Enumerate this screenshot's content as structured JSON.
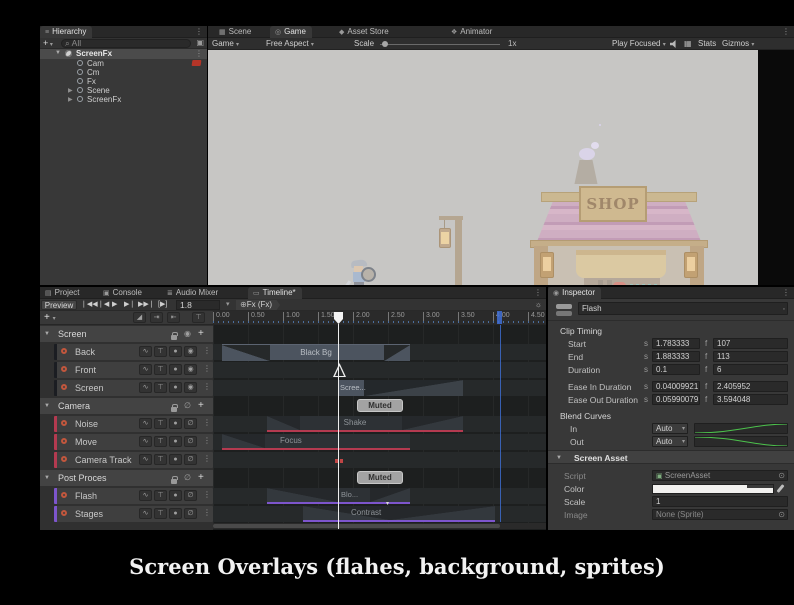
{
  "caption": "Screen Overlays (flahes, background, sprites)",
  "hierarchy": {
    "tab": "Hierarchy",
    "add_label": "+",
    "search_value": "All",
    "root": "ScreenFx",
    "children": [
      {
        "name": "Cam"
      },
      {
        "name": "Cm"
      },
      {
        "name": "Fx"
      },
      {
        "name": "Scene"
      },
      {
        "name": "ScreenFx"
      }
    ]
  },
  "game": {
    "tabs": [
      {
        "label": "Scene"
      },
      {
        "label": "Game"
      },
      {
        "label": "Asset Store"
      },
      {
        "label": "Animator"
      }
    ],
    "toolbar": {
      "display": "Game",
      "aspect": "Free Aspect",
      "scale_label": "Scale",
      "scale_value": "1x",
      "play_focused": "Play Focused",
      "stats_label": "Stats",
      "gizmos_label": "Gizmos"
    },
    "scene": {
      "shop_sign": "SHOP"
    }
  },
  "timeline": {
    "tabs": [
      {
        "label": "Project"
      },
      {
        "label": "Console"
      },
      {
        "label": "Audio Mixer"
      },
      {
        "label": "Timeline*"
      }
    ],
    "transport": {
      "preview": "Preview",
      "time": "1.8",
      "binding": "Fx (Fx)"
    },
    "ruler": [
      "0.00",
      "0.50",
      "1.00",
      "1.50",
      "2.00",
      "2.50",
      "3.00",
      "3.50",
      "4.00",
      "4.50"
    ],
    "groups": [
      {
        "name": "Screen",
        "tracks": [
          {
            "name": "Back"
          },
          {
            "name": "Front"
          },
          {
            "name": "Screen"
          }
        ]
      },
      {
        "name": "Camera",
        "tracks": [
          {
            "name": "Noise"
          },
          {
            "name": "Move"
          },
          {
            "name": "Camera Track"
          }
        ]
      },
      {
        "name": "Post Proces",
        "tracks": [
          {
            "name": "Flash"
          },
          {
            "name": "Stages"
          }
        ]
      }
    ],
    "clips": {
      "black_bg": "Black Bg",
      "screen": "Scree...",
      "shake": "Shake",
      "focus": "Focus",
      "bloom": "Blo...",
      "contrast": "Contrast",
      "muted_label": "Muted"
    },
    "colors": {
      "camera_track": "#b43a50",
      "post_track": "#7d55cc",
      "end_marker": "#3f6fd6"
    }
  },
  "inspector": {
    "tab": "Inspector",
    "clip_name": "Flash",
    "section_clip_timing": "Clip Timing",
    "rows": [
      {
        "label": "Start",
        "s": "1.783333",
        "f": "107"
      },
      {
        "label": "End",
        "s": "1.883333",
        "f": "113"
      },
      {
        "label": "Duration",
        "s": "0.1",
        "f": "6"
      },
      {
        "label": "Ease In Duration",
        "s": "0.04009921",
        "f": "2.405952"
      },
      {
        "label": "Ease Out Duration",
        "s": "0.05990079",
        "f": "3.594048"
      }
    ],
    "s_prefix": "s",
    "f_prefix": "f",
    "section_blend": "Blend Curves",
    "blend": {
      "in_label": "In",
      "out_label": "Out",
      "in_value": "Auto",
      "out_value": "Auto"
    },
    "section_asset": "Screen Asset",
    "asset": {
      "script_label": "Script",
      "script_value": "ScreenAsset",
      "color_label": "Color",
      "scale_label": "Scale",
      "scale_value": "1",
      "image_label": "Image",
      "image_value": "None (Sprite)"
    }
  }
}
